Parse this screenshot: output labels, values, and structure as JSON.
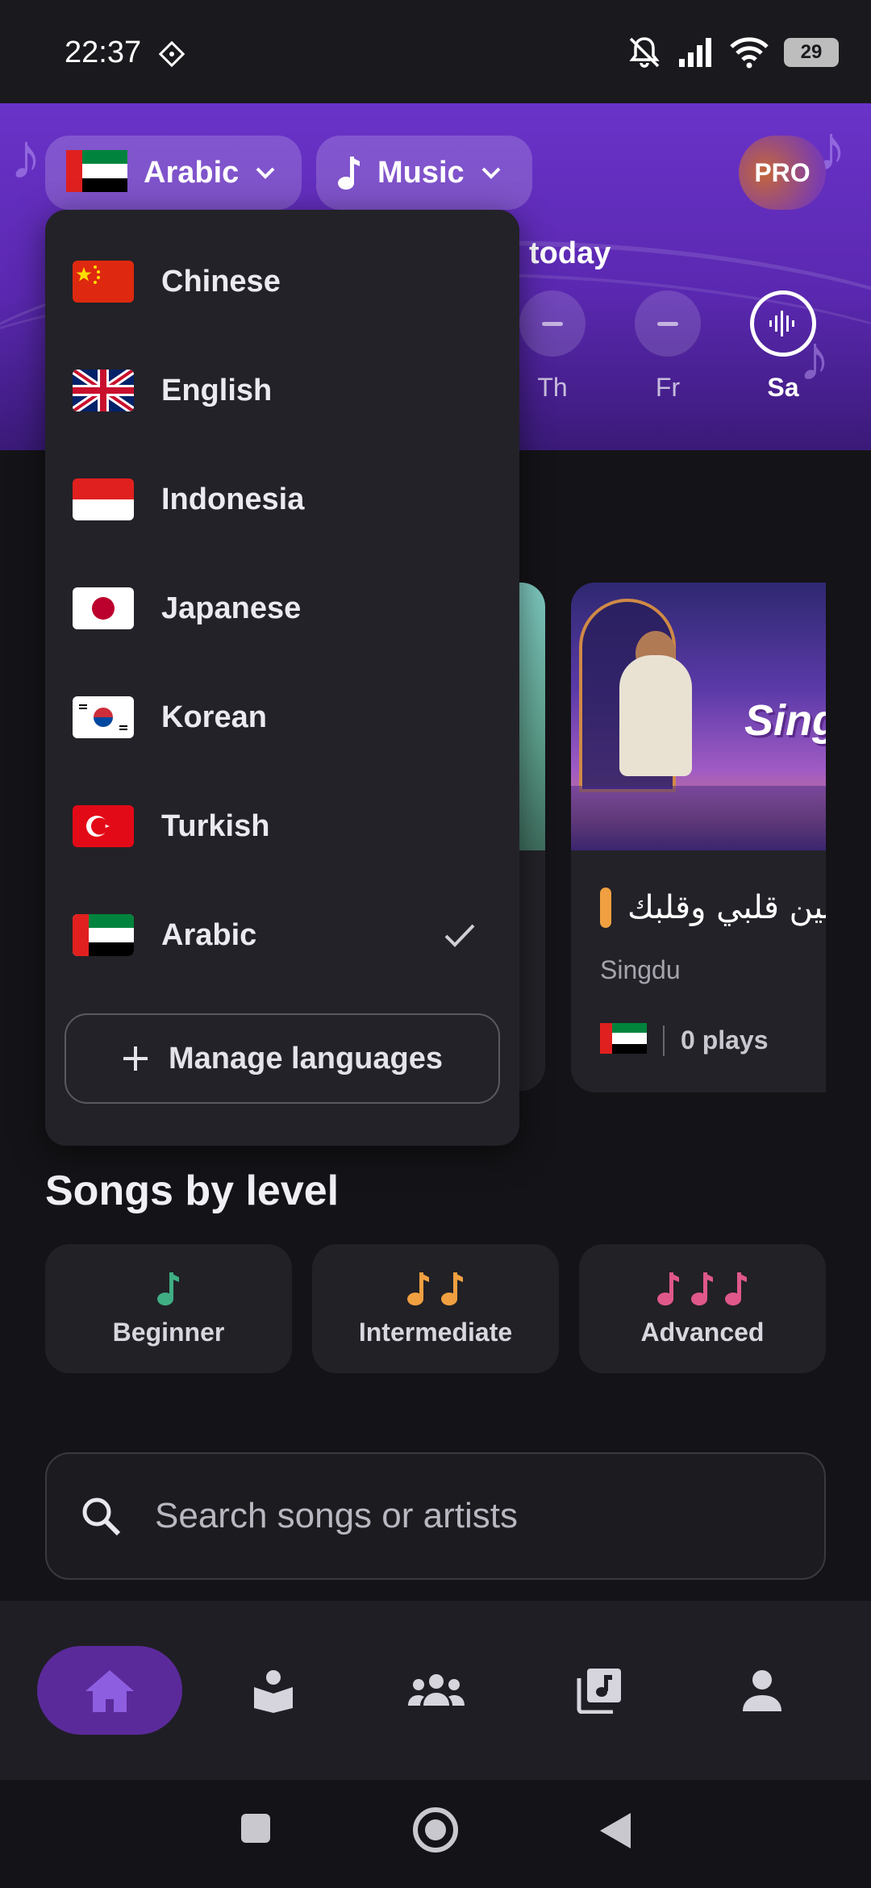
{
  "status_bar": {
    "time": "22:37",
    "battery": "29"
  },
  "header": {
    "language_label": "Arabic",
    "category_label": "Music",
    "pro_label": "PRO",
    "streak_text": "today",
    "days": [
      {
        "label": "Th",
        "state": "empty"
      },
      {
        "label": "Fr",
        "state": "empty"
      },
      {
        "label": "Sa",
        "state": "active"
      }
    ]
  },
  "language_menu": {
    "items": [
      {
        "label": "Chinese",
        "flag": "china-flag-icon"
      },
      {
        "label": "English",
        "flag": "uk-flag-icon"
      },
      {
        "label": "Indonesia",
        "flag": "indonesia-flag-icon"
      },
      {
        "label": "Japanese",
        "flag": "japan-flag-icon"
      },
      {
        "label": "Korean",
        "flag": "korea-flag-icon"
      },
      {
        "label": "Turkish",
        "flag": "turkey-flag-icon"
      },
      {
        "label": "Arabic",
        "flag": "uae-flag-icon",
        "selected": true
      }
    ],
    "manage_label": "Manage languages"
  },
  "song_card": {
    "title": "بين قلبي وقلبك",
    "artist": "Singdu",
    "plays": "0 plays",
    "art_text": "Sing"
  },
  "levels": {
    "title": "Songs by level",
    "items": [
      {
        "label": "Beginner",
        "color": "#3fae84"
      },
      {
        "label": "Intermediate",
        "color": "#f0a040"
      },
      {
        "label": "Advanced",
        "color": "#e0588a"
      }
    ]
  },
  "search": {
    "placeholder": "Search songs or artists"
  },
  "colors": {
    "accent": "#5b2a9a",
    "hero": "#6a33c9"
  }
}
